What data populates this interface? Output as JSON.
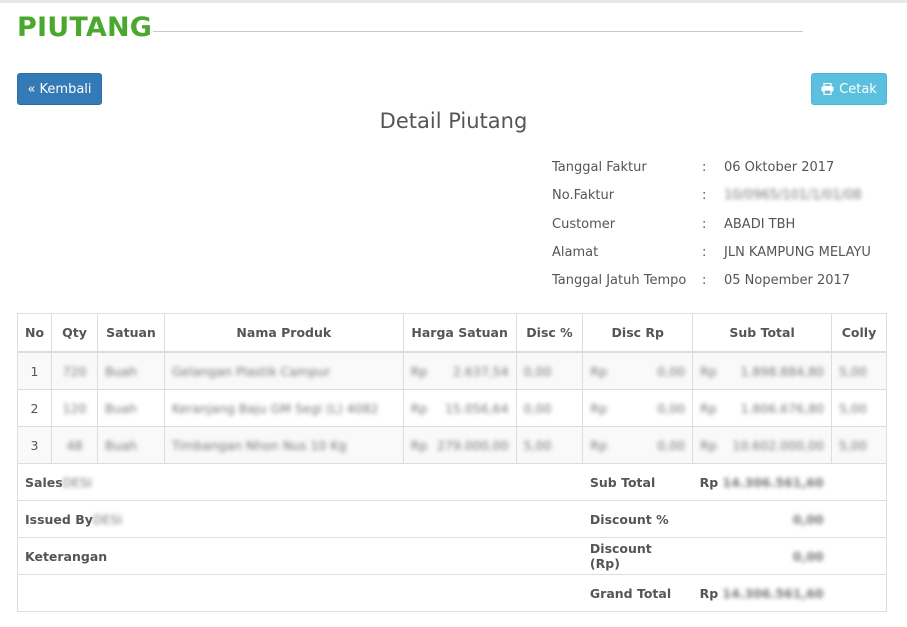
{
  "header": {
    "title": "PIUTANG"
  },
  "buttons": {
    "back": "« Kembali",
    "print": "Cetak"
  },
  "icons": {
    "print": "print-icon"
  },
  "colors": {
    "title_green": "#4aa82e",
    "back_button": "#337ab7",
    "print_button": "#5bc0de"
  },
  "detail": {
    "heading": "Detail Piutang",
    "fields": [
      {
        "label": "Tanggal Faktur",
        "value": "06 Oktober 2017",
        "blurred": false
      },
      {
        "label": "No.Faktur",
        "value": "10/0965/101/1/01/08",
        "blurred": true
      },
      {
        "label": "Customer",
        "value": "ABADI TBH",
        "blurred": false
      },
      {
        "label": "Alamat",
        "value": "JLN KAMPUNG MELAYU",
        "blurred": false
      },
      {
        "label": "Tanggal Jatuh Tempo",
        "value": "05 Nopember 2017",
        "blurred": false
      }
    ]
  },
  "table": {
    "columns": [
      "No",
      "Qty",
      "Satuan",
      "Nama Produk",
      "Harga Satuan",
      "Disc %",
      "Disc Rp",
      "Sub Total",
      "Colly"
    ],
    "rows": [
      {
        "no": "1",
        "qty": "720",
        "satuan": "Buah",
        "produk": "Gelangan Plastik Campur",
        "rp1": "Rp",
        "harga": "2.637,54",
        "disc_pct": "0,00",
        "rp2": "Rp",
        "disc_rp": "0,00",
        "rp3": "Rp",
        "subtotal": "1.898.884,80",
        "colly": "5,00"
      },
      {
        "no": "2",
        "qty": "120",
        "satuan": "Buah",
        "produk": "Keranjang Baju GM Segi (L) 4082",
        "rp1": "Rp",
        "harga": "15.056,64",
        "disc_pct": "0,00",
        "rp2": "Rp",
        "disc_rp": "0,00",
        "rp3": "Rp",
        "subtotal": "1.806.676,80",
        "colly": "5,00"
      },
      {
        "no": "3",
        "qty": "48",
        "satuan": "Buah",
        "produk": "Timbangan Nhon Nus 10 Kg",
        "rp1": "Rp",
        "harga": "279.000,00",
        "disc_pct": "5,00",
        "rp2": "Rp",
        "disc_rp": "0,00",
        "rp3": "Rp",
        "subtotal": "10.602.000,00",
        "colly": "5,00"
      }
    ],
    "footer": {
      "sales_label": "Sales",
      "sales_value": "DESI",
      "issued_label": "Issued By",
      "issued_value": "DESI",
      "keterangan_label": "Keterangan",
      "subtotal_label": "Sub Total",
      "subtotal_rp": "Rp",
      "subtotal_value": "14.306.561,60",
      "discount_pct_label": "Discount %",
      "discount_pct_value": "0,00",
      "discount_rp_label": "Discount (Rp)",
      "discount_rp_value": "0,00",
      "grand_total_label": "Grand Total",
      "grand_total_rp": "Rp",
      "grand_total_value": "14.306.561,60"
    }
  }
}
